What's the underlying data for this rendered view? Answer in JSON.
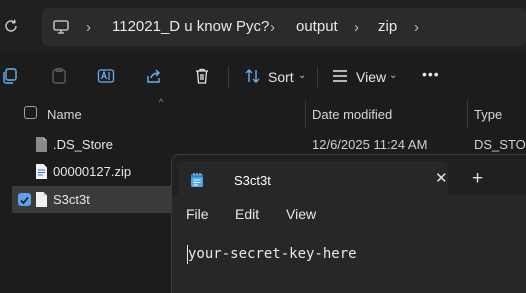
{
  "address_bar": {
    "crumbs": [
      "112021_D u know Pyc?",
      "output",
      "zip"
    ]
  },
  "toolbar": {
    "sort_label": "Sort",
    "view_label": "View",
    "more_label": "•••"
  },
  "columns": {
    "name": "Name",
    "date_modified": "Date modified",
    "type": "Type"
  },
  "files": [
    {
      "name": ".DS_Store",
      "date": "12/6/2025 11:24 AM",
      "type": "DS_STORE",
      "selected": false
    },
    {
      "name": "00000127.zip",
      "date": "",
      "type": "",
      "selected": false
    },
    {
      "name": "S3ct3t",
      "date": "",
      "type": "",
      "selected": true
    }
  ],
  "notepad": {
    "tab_title": "S3ct3t",
    "close_glyph": "✕",
    "new_tab_glyph": "+",
    "menu": [
      "File",
      "Edit",
      "View"
    ],
    "content": "your-secret-key-here"
  },
  "colors": {
    "accent": "#5ea1e8",
    "background": "#1c1c1c",
    "selection": "#3a3a3a"
  }
}
